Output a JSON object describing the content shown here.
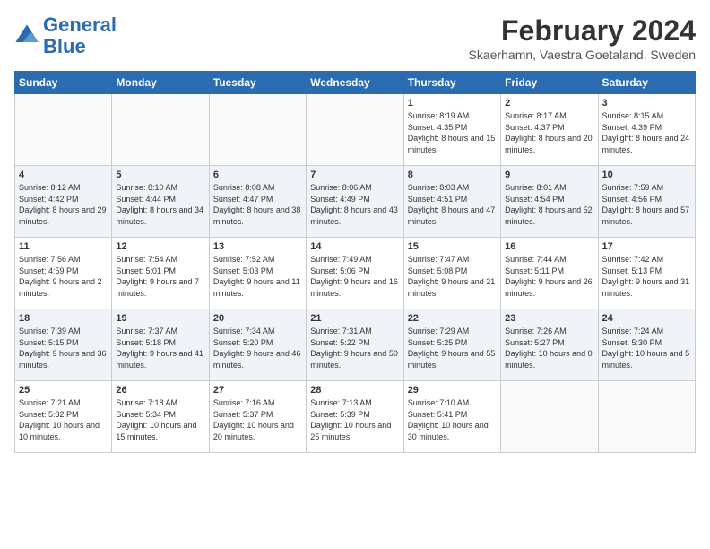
{
  "header": {
    "logo_line1": "General",
    "logo_line2": "Blue",
    "month": "February 2024",
    "location": "Skaerhamn, Vaestra Goetaland, Sweden"
  },
  "weekdays": [
    "Sunday",
    "Monday",
    "Tuesday",
    "Wednesday",
    "Thursday",
    "Friday",
    "Saturday"
  ],
  "weeks": [
    [
      {
        "day": "",
        "sunrise": "",
        "sunset": "",
        "daylight": ""
      },
      {
        "day": "",
        "sunrise": "",
        "sunset": "",
        "daylight": ""
      },
      {
        "day": "",
        "sunrise": "",
        "sunset": "",
        "daylight": ""
      },
      {
        "day": "",
        "sunrise": "",
        "sunset": "",
        "daylight": ""
      },
      {
        "day": "1",
        "sunrise": "Sunrise: 8:19 AM",
        "sunset": "Sunset: 4:35 PM",
        "daylight": "Daylight: 8 hours and 15 minutes."
      },
      {
        "day": "2",
        "sunrise": "Sunrise: 8:17 AM",
        "sunset": "Sunset: 4:37 PM",
        "daylight": "Daylight: 8 hours and 20 minutes."
      },
      {
        "day": "3",
        "sunrise": "Sunrise: 8:15 AM",
        "sunset": "Sunset: 4:39 PM",
        "daylight": "Daylight: 8 hours and 24 minutes."
      }
    ],
    [
      {
        "day": "4",
        "sunrise": "Sunrise: 8:12 AM",
        "sunset": "Sunset: 4:42 PM",
        "daylight": "Daylight: 8 hours and 29 minutes."
      },
      {
        "day": "5",
        "sunrise": "Sunrise: 8:10 AM",
        "sunset": "Sunset: 4:44 PM",
        "daylight": "Daylight: 8 hours and 34 minutes."
      },
      {
        "day": "6",
        "sunrise": "Sunrise: 8:08 AM",
        "sunset": "Sunset: 4:47 PM",
        "daylight": "Daylight: 8 hours and 38 minutes."
      },
      {
        "day": "7",
        "sunrise": "Sunrise: 8:06 AM",
        "sunset": "Sunset: 4:49 PM",
        "daylight": "Daylight: 8 hours and 43 minutes."
      },
      {
        "day": "8",
        "sunrise": "Sunrise: 8:03 AM",
        "sunset": "Sunset: 4:51 PM",
        "daylight": "Daylight: 8 hours and 47 minutes."
      },
      {
        "day": "9",
        "sunrise": "Sunrise: 8:01 AM",
        "sunset": "Sunset: 4:54 PM",
        "daylight": "Daylight: 8 hours and 52 minutes."
      },
      {
        "day": "10",
        "sunrise": "Sunrise: 7:59 AM",
        "sunset": "Sunset: 4:56 PM",
        "daylight": "Daylight: 8 hours and 57 minutes."
      }
    ],
    [
      {
        "day": "11",
        "sunrise": "Sunrise: 7:56 AM",
        "sunset": "Sunset: 4:59 PM",
        "daylight": "Daylight: 9 hours and 2 minutes."
      },
      {
        "day": "12",
        "sunrise": "Sunrise: 7:54 AM",
        "sunset": "Sunset: 5:01 PM",
        "daylight": "Daylight: 9 hours and 7 minutes."
      },
      {
        "day": "13",
        "sunrise": "Sunrise: 7:52 AM",
        "sunset": "Sunset: 5:03 PM",
        "daylight": "Daylight: 9 hours and 11 minutes."
      },
      {
        "day": "14",
        "sunrise": "Sunrise: 7:49 AM",
        "sunset": "Sunset: 5:06 PM",
        "daylight": "Daylight: 9 hours and 16 minutes."
      },
      {
        "day": "15",
        "sunrise": "Sunrise: 7:47 AM",
        "sunset": "Sunset: 5:08 PM",
        "daylight": "Daylight: 9 hours and 21 minutes."
      },
      {
        "day": "16",
        "sunrise": "Sunrise: 7:44 AM",
        "sunset": "Sunset: 5:11 PM",
        "daylight": "Daylight: 9 hours and 26 minutes."
      },
      {
        "day": "17",
        "sunrise": "Sunrise: 7:42 AM",
        "sunset": "Sunset: 5:13 PM",
        "daylight": "Daylight: 9 hours and 31 minutes."
      }
    ],
    [
      {
        "day": "18",
        "sunrise": "Sunrise: 7:39 AM",
        "sunset": "Sunset: 5:15 PM",
        "daylight": "Daylight: 9 hours and 36 minutes."
      },
      {
        "day": "19",
        "sunrise": "Sunrise: 7:37 AM",
        "sunset": "Sunset: 5:18 PM",
        "daylight": "Daylight: 9 hours and 41 minutes."
      },
      {
        "day": "20",
        "sunrise": "Sunrise: 7:34 AM",
        "sunset": "Sunset: 5:20 PM",
        "daylight": "Daylight: 9 hours and 46 minutes."
      },
      {
        "day": "21",
        "sunrise": "Sunrise: 7:31 AM",
        "sunset": "Sunset: 5:22 PM",
        "daylight": "Daylight: 9 hours and 50 minutes."
      },
      {
        "day": "22",
        "sunrise": "Sunrise: 7:29 AM",
        "sunset": "Sunset: 5:25 PM",
        "daylight": "Daylight: 9 hours and 55 minutes."
      },
      {
        "day": "23",
        "sunrise": "Sunrise: 7:26 AM",
        "sunset": "Sunset: 5:27 PM",
        "daylight": "Daylight: 10 hours and 0 minutes."
      },
      {
        "day": "24",
        "sunrise": "Sunrise: 7:24 AM",
        "sunset": "Sunset: 5:30 PM",
        "daylight": "Daylight: 10 hours and 5 minutes."
      }
    ],
    [
      {
        "day": "25",
        "sunrise": "Sunrise: 7:21 AM",
        "sunset": "Sunset: 5:32 PM",
        "daylight": "Daylight: 10 hours and 10 minutes."
      },
      {
        "day": "26",
        "sunrise": "Sunrise: 7:18 AM",
        "sunset": "Sunset: 5:34 PM",
        "daylight": "Daylight: 10 hours and 15 minutes."
      },
      {
        "day": "27",
        "sunrise": "Sunrise: 7:16 AM",
        "sunset": "Sunset: 5:37 PM",
        "daylight": "Daylight: 10 hours and 20 minutes."
      },
      {
        "day": "28",
        "sunrise": "Sunrise: 7:13 AM",
        "sunset": "Sunset: 5:39 PM",
        "daylight": "Daylight: 10 hours and 25 minutes."
      },
      {
        "day": "29",
        "sunrise": "Sunrise: 7:10 AM",
        "sunset": "Sunset: 5:41 PM",
        "daylight": "Daylight: 10 hours and 30 minutes."
      },
      {
        "day": "",
        "sunrise": "",
        "sunset": "",
        "daylight": ""
      },
      {
        "day": "",
        "sunrise": "",
        "sunset": "",
        "daylight": ""
      }
    ]
  ]
}
